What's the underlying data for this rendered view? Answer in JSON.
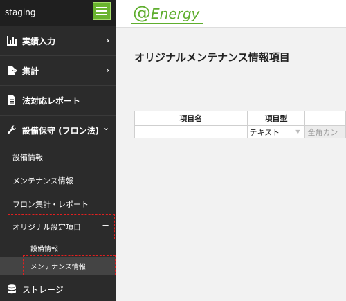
{
  "sidebar": {
    "env_label": "staging",
    "menu": [
      {
        "label": "実績入力",
        "icon": "bar-chart-icon"
      },
      {
        "label": "集計",
        "icon": "file-export-icon"
      },
      {
        "label": "法対応レポート",
        "icon": "document-icon"
      },
      {
        "label": "設備保守 (フロン法)",
        "icon": "wrench-icon"
      },
      {
        "label": "ストレージ",
        "icon": "database-icon"
      }
    ],
    "submenu": [
      {
        "label": "設備情報"
      },
      {
        "label": "メンテナンス情報"
      },
      {
        "label": "フロン集計・レポート"
      },
      {
        "label": "オリジナル設定項目"
      }
    ],
    "subsubmenu": [
      {
        "label": "設備情報"
      },
      {
        "label": "メンテナンス情報"
      }
    ],
    "arrow_right": "›",
    "arrow_down": "⌄",
    "collapse": "−"
  },
  "header": {
    "logo_at": "@",
    "logo_word": "Energy"
  },
  "main": {
    "title": "オリジナルメンテナンス情報項目",
    "table": {
      "headers": [
        "項目名",
        "項目型",
        ""
      ],
      "row": {
        "name_value": "",
        "type_value": "テキスト",
        "option_value": "全角カン"
      }
    }
  },
  "colors": {
    "accent": "#5fae2e",
    "sidebar_bg": "#2b2b2b",
    "highlight": "#e02020"
  }
}
